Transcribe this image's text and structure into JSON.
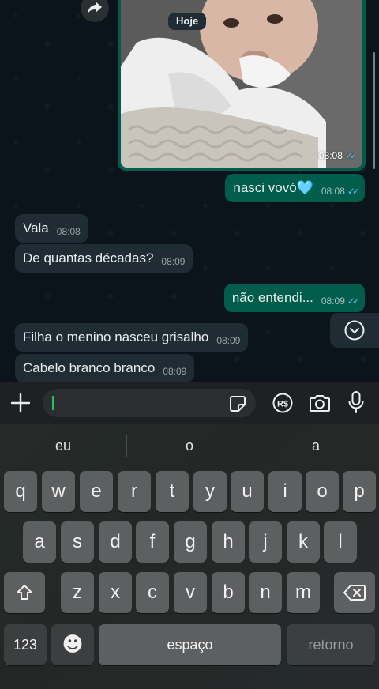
{
  "chat": {
    "date_separator": "Hoje",
    "image_message": {
      "time": "08:08",
      "ticks": "✓✓"
    },
    "messages": [
      {
        "direction": "out",
        "text": "nasci vovó🩵",
        "time": "08:08",
        "ticks": "✓✓"
      },
      {
        "direction": "in",
        "text": "Vala",
        "time": "08:08"
      },
      {
        "direction": "in",
        "text": "De quantas décadas?",
        "time": "08:09"
      },
      {
        "direction": "out",
        "text": "não entendi...",
        "time": "08:09",
        "ticks": "✓✓"
      },
      {
        "direction": "in",
        "text": "Filha o menino nasceu grisalho",
        "time": "08:09"
      },
      {
        "direction": "in",
        "text": "Cabelo branco branco",
        "time": "08:09"
      }
    ]
  },
  "input_bar": {
    "icons": [
      "plus-icon",
      "sticker-icon",
      "payment-rs-icon",
      "camera-icon",
      "microphone-icon"
    ],
    "rs_label": "R$"
  },
  "keyboard": {
    "suggestions": [
      "eu",
      "o",
      "a"
    ],
    "row1": [
      "q",
      "w",
      "e",
      "r",
      "t",
      "y",
      "u",
      "i",
      "o",
      "p"
    ],
    "row2": [
      "a",
      "s",
      "d",
      "f",
      "g",
      "h",
      "j",
      "k",
      "l"
    ],
    "row3": [
      "z",
      "x",
      "c",
      "v",
      "b",
      "n",
      "m"
    ],
    "numbers_label": "123",
    "space_label": "espaço",
    "return_label": "retorno",
    "emoji": "☻"
  },
  "colors": {
    "outgoing_bubble": "#005c4b",
    "incoming_bubble": "#202c33",
    "read_ticks": "#53bdeb",
    "chat_background": "#0b141a",
    "keyboard_key": "#5d5f61"
  }
}
